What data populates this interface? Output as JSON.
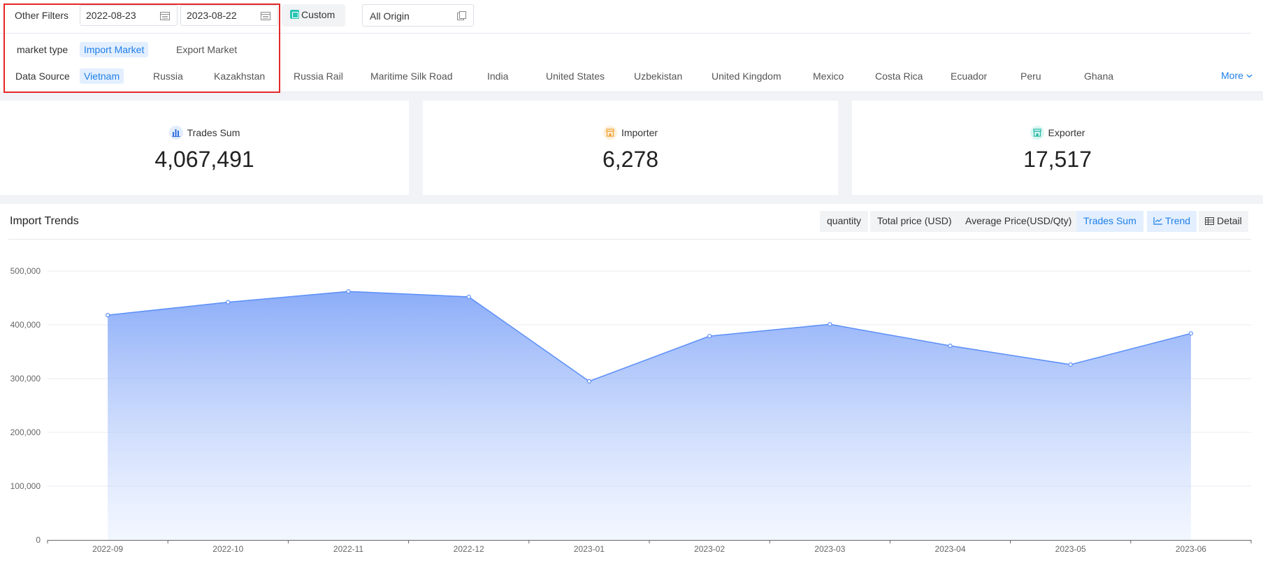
{
  "filters": {
    "other_filters_label": "Other Filters",
    "start_date": "2022-08-23",
    "end_date": "2023-08-22",
    "custom_label": "Custom",
    "origin_value": "All Origin",
    "market_type_label": "market type",
    "market_types": [
      "Import Market",
      "Export Market"
    ],
    "data_source_label": "Data Source",
    "data_sources": [
      "Vietnam",
      "Russia",
      "Kazakhstan",
      "Russia Rail",
      "Maritime Silk Road",
      "India",
      "United States",
      "Uzbekistan",
      "United Kingdom",
      "Mexico",
      "Costa Rica",
      "Ecuador",
      "Peru",
      "Ghana"
    ],
    "more_label": "More"
  },
  "stats": {
    "trades_sum_label": "Trades Sum",
    "trades_sum_value": "4,067,491",
    "importer_label": "Importer",
    "importer_value": "6,278",
    "exporter_label": "Exporter",
    "exporter_value": "17,517"
  },
  "trends": {
    "title": "Import Trends",
    "metrics": [
      "quantity",
      "Total price (USD)",
      "Average Price(USD/Qty)",
      "Trades Sum"
    ],
    "active_metric": "Trades Sum",
    "trend_label": "Trend",
    "detail_label": "Detail"
  },
  "colors": {
    "accent": "#1f7fe8",
    "line": "#5b8ff9",
    "highlight_box": "#e32828"
  },
  "chart_data": {
    "type": "area",
    "title": "",
    "x": [
      "2022-09",
      "2022-10",
      "2022-11",
      "2022-12",
      "2023-01",
      "2023-02",
      "2023-03",
      "2023-04",
      "2023-05",
      "2023-06"
    ],
    "series": [
      {
        "values": [
          418000,
          442000,
          462000,
          452000,
          295000,
          379000,
          401000,
          361000,
          326000,
          384000
        ]
      }
    ],
    "yticks": [
      "0",
      "100,000",
      "200,000",
      "300,000",
      "400,000",
      "500,000"
    ],
    "ylim": [
      0,
      500000
    ],
    "grid": true,
    "legend": "none"
  }
}
